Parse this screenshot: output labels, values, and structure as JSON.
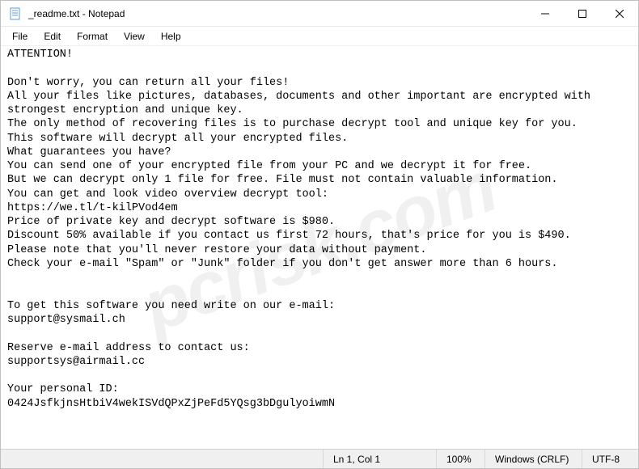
{
  "window": {
    "title": "_readme.txt - Notepad",
    "icon_name": "notepad-icon"
  },
  "menu": {
    "items": [
      "File",
      "Edit",
      "Format",
      "View",
      "Help"
    ]
  },
  "content": {
    "text": "ATTENTION!\n\nDon't worry, you can return all your files!\nAll your files like pictures, databases, documents and other important are encrypted with strongest encryption and unique key.\nThe only method of recovering files is to purchase decrypt tool and unique key for you.\nThis software will decrypt all your encrypted files.\nWhat guarantees you have?\nYou can send one of your encrypted file from your PC and we decrypt it for free.\nBut we can decrypt only 1 file for free. File must not contain valuable information.\nYou can get and look video overview decrypt tool:\nhttps://we.tl/t-kilPVod4em\nPrice of private key and decrypt software is $980.\nDiscount 50% available if you contact us first 72 hours, that's price for you is $490.\nPlease note that you'll never restore your data without payment.\nCheck your e-mail \"Spam\" or \"Junk\" folder if you don't get answer more than 6 hours.\n\n\nTo get this software you need write on our e-mail:\nsupport@sysmail.ch\n\nReserve e-mail address to contact us:\nsupportsys@airmail.cc\n\nYour personal ID:\n0424JsfkjnsHtbiV4wekISVdQPxZjPeFd5YQsg3bDgulyoiwmN"
  },
  "statusbar": {
    "position": "Ln 1, Col 1",
    "zoom": "100%",
    "line_ending": "Windows (CRLF)",
    "encoding": "UTF-8"
  },
  "watermark": "pcrisk.com"
}
